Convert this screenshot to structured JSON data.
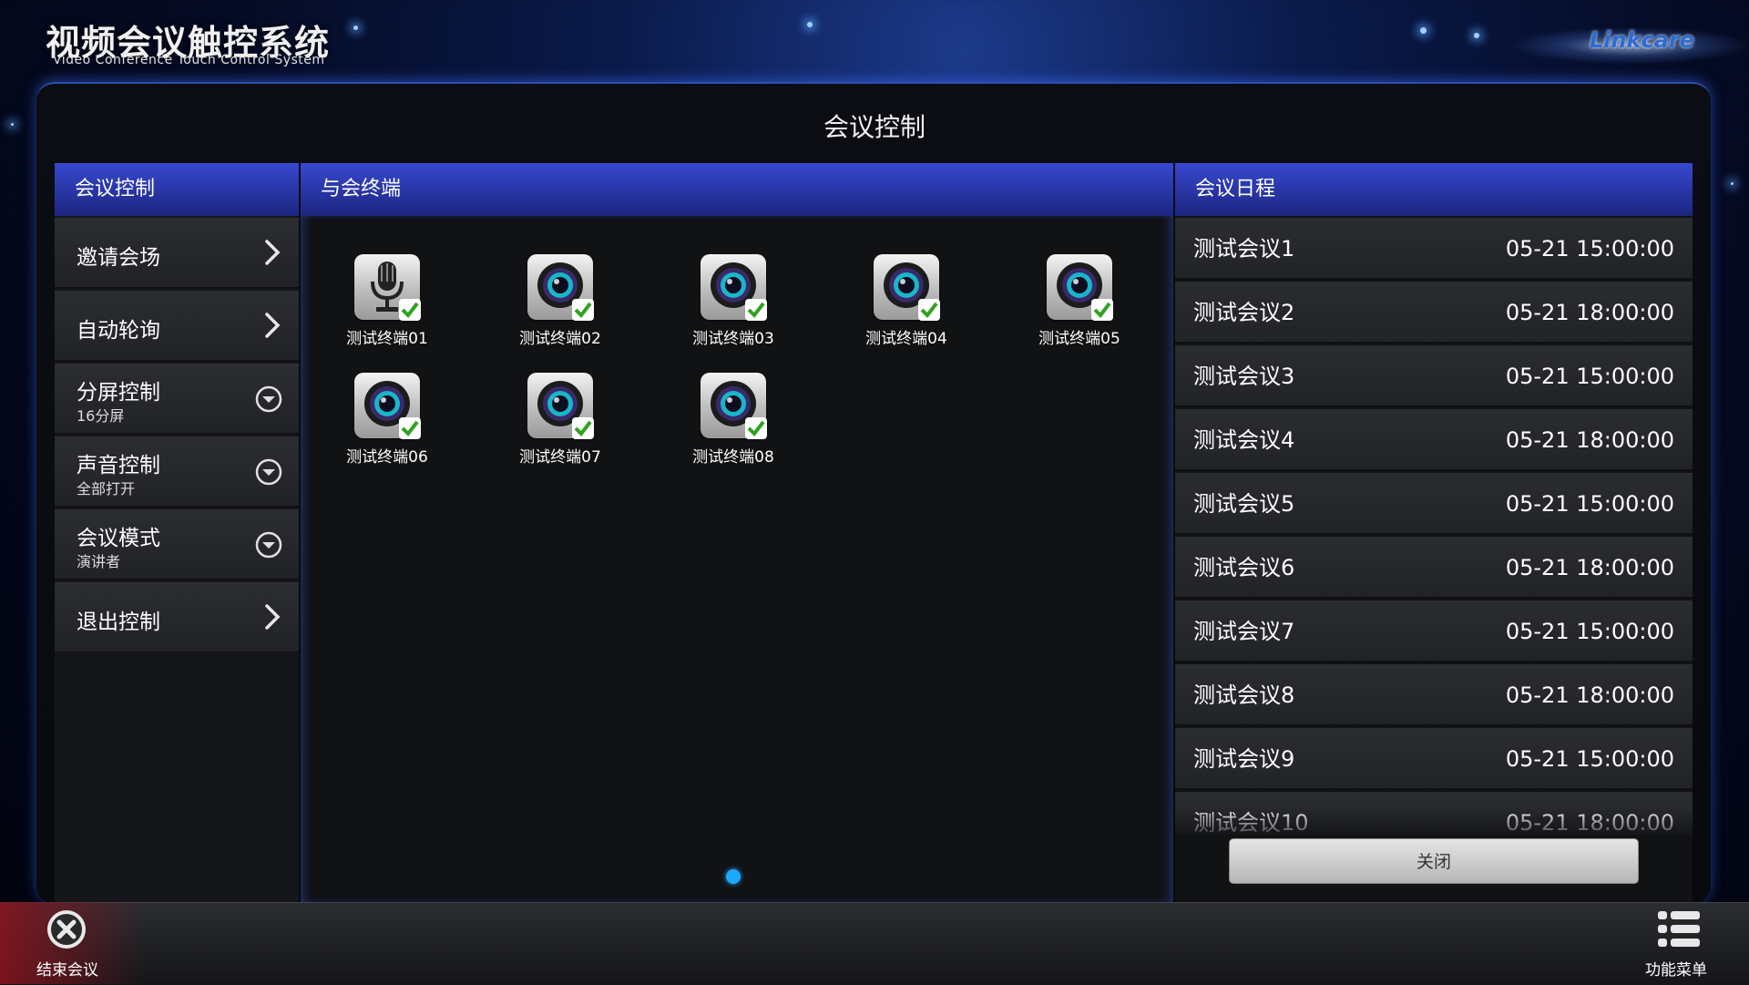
{
  "header": {
    "title_cn": "视频会议触控系统",
    "title_en": "Video Conference Touch Control System",
    "brand": "Linkcare"
  },
  "page_title": "会议控制",
  "panels": {
    "left_header": "会议控制",
    "center_header": "与会终端",
    "right_header": "会议日程"
  },
  "menu": [
    {
      "label": "邀请会场",
      "sub": "",
      "icon": "chevron-right-icon"
    },
    {
      "label": "自动轮询",
      "sub": "",
      "icon": "chevron-right-icon"
    },
    {
      "label": "分屏控制",
      "sub": "16分屏",
      "icon": "chevron-down-circle-icon"
    },
    {
      "label": "声音控制",
      "sub": "全部打开",
      "icon": "chevron-down-circle-icon"
    },
    {
      "label": "会议模式",
      "sub": "演讲者",
      "icon": "chevron-down-circle-icon"
    },
    {
      "label": "退出控制",
      "sub": "",
      "icon": "chevron-right-icon"
    }
  ],
  "terminals": [
    {
      "label": "测试终端01",
      "type": "microphone-icon",
      "checked": true
    },
    {
      "label": "测试终端02",
      "type": "camera-icon",
      "checked": true
    },
    {
      "label": "测试终端03",
      "type": "camera-icon",
      "checked": true
    },
    {
      "label": "测试终端04",
      "type": "camera-icon",
      "checked": true
    },
    {
      "label": "测试终端05",
      "type": "camera-icon",
      "checked": true
    },
    {
      "label": "测试终端06",
      "type": "camera-icon",
      "checked": true
    },
    {
      "label": "测试终端07",
      "type": "camera-icon",
      "checked": true
    },
    {
      "label": "测试终端08",
      "type": "camera-icon",
      "checked": true
    }
  ],
  "schedule": [
    {
      "name": "测试会议1",
      "time": "05-21 15:00:00"
    },
    {
      "name": "测试会议2",
      "time": "05-21 18:00:00"
    },
    {
      "name": "测试会议3",
      "time": "05-21 15:00:00"
    },
    {
      "name": "测试会议4",
      "time": "05-21 18:00:00"
    },
    {
      "name": "测试会议5",
      "time": "05-21 15:00:00"
    },
    {
      "name": "测试会议6",
      "time": "05-21 18:00:00"
    },
    {
      "name": "测试会议7",
      "time": "05-21 15:00:00"
    },
    {
      "name": "测试会议8",
      "time": "05-21 18:00:00"
    },
    {
      "name": "测试会议9",
      "time": "05-21 15:00:00"
    },
    {
      "name": "测试会议10",
      "time": "05-21 18:00:00"
    }
  ],
  "close_label": "关闭",
  "bottom": {
    "end_label": "结束会议",
    "menu_label": "功能菜单"
  },
  "colors": {
    "header_blue": "#2b3bb8",
    "pager_active": "#1ea7ff",
    "check_green": "#2fa21f"
  }
}
